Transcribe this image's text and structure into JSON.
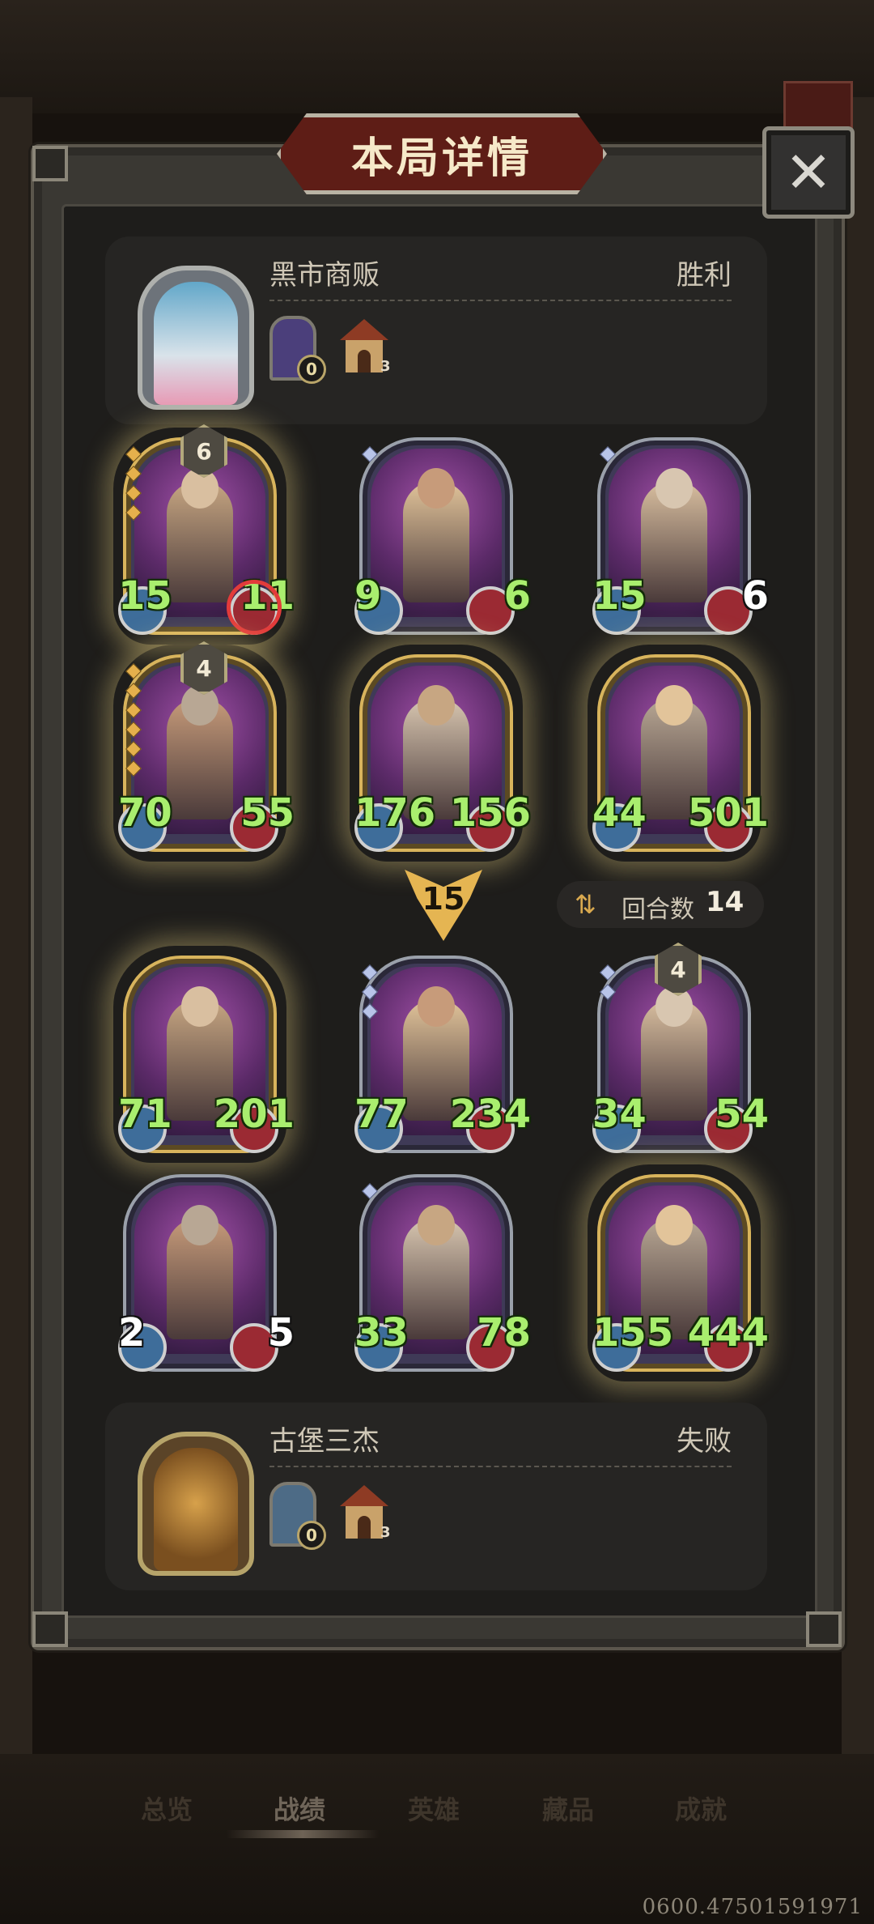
{
  "dialog": {
    "title": "本局详情",
    "close_icon": "close-icon"
  },
  "players": {
    "top": {
      "name": "黑市商贩",
      "result": "胜利",
      "items": [
        {
          "icon": "door-icon",
          "count": "0"
        },
        {
          "icon": "house-icon",
          "count": "3"
        }
      ]
    },
    "bottom": {
      "name": "古堡三杰",
      "result": "失败",
      "items": [
        {
          "icon": "door-icon",
          "count": "0"
        },
        {
          "icon": "house-icon",
          "count": "3"
        }
      ]
    }
  },
  "top_board": [
    {
      "name": "sword-knight",
      "attack": "15",
      "health": "11",
      "tier": "6",
      "frame": "gold",
      "pips": 4,
      "pip_color": "gold",
      "atk_color": "green",
      "hp_color": "green"
    },
    {
      "name": "pirate-captain",
      "attack": "9",
      "health": "6",
      "frame": "silver",
      "pips": 1,
      "pip_color": "silver",
      "atk_color": "green",
      "hp_color": "green"
    },
    {
      "name": "armored-paladin",
      "attack": "15",
      "health": "6",
      "frame": "silver",
      "pips": 1,
      "pip_color": "silver",
      "atk_color": "green",
      "hp_color": "white"
    },
    {
      "name": "pirate-bandana",
      "attack": "70",
      "health": "55",
      "tier": "4",
      "frame": "gold",
      "pips": 6,
      "pip_color": "gold",
      "atk_color": "green",
      "hp_color": "green"
    },
    {
      "name": "valkyrie",
      "attack": "176",
      "health": "156",
      "frame": "gold",
      "pips": 0,
      "pip_color": "gold",
      "atk_color": "green",
      "hp_color": "green"
    },
    {
      "name": "viking-warrior",
      "attack": "44",
      "health": "501",
      "frame": "gold",
      "pips": 0,
      "pip_color": "gold",
      "atk_color": "green",
      "hp_color": "green"
    }
  ],
  "round": {
    "turn_badge": "15",
    "label": "回合数",
    "value": "14",
    "icon": "swap-icon"
  },
  "bottom_board": [
    {
      "name": "archer",
      "attack": "71",
      "health": "201",
      "frame": "gold",
      "pips": 0,
      "pip_color": "gold",
      "atk_color": "green",
      "hp_color": "green"
    },
    {
      "name": "engineer-pair",
      "attack": "77",
      "health": "234",
      "frame": "silver",
      "pips": 3,
      "pip_color": "silver",
      "atk_color": "green",
      "hp_color": "green"
    },
    {
      "name": "shield-warrior",
      "attack": "34",
      "health": "54",
      "tier": "4",
      "frame": "silver",
      "pips": 2,
      "pip_color": "silver",
      "atk_color": "green",
      "hp_color": "green"
    },
    {
      "name": "purple-brawler",
      "attack": "2",
      "health": "5",
      "frame": "silver",
      "pips": 0,
      "pip_color": "silver",
      "atk_color": "white",
      "hp_color": "white"
    },
    {
      "name": "armored-paladin",
      "attack": "33",
      "health": "78",
      "frame": "silver",
      "pips": 1,
      "pip_color": "silver",
      "atk_color": "green",
      "hp_color": "green"
    },
    {
      "name": "blacksmith-girl",
      "attack": "155",
      "health": "444",
      "frame": "gold",
      "pips": 0,
      "pip_color": "gold",
      "atk_color": "green",
      "hp_color": "green"
    }
  ],
  "nav": {
    "tabs": [
      "总览",
      "战绩",
      "英雄",
      "藏品",
      "成就"
    ],
    "active": "战绩"
  },
  "version": "0600.47501591971",
  "colors": {
    "stat_green": "#a9ee6e",
    "gold_frame": "#d8b45c",
    "silver_frame": "#9aa0aa",
    "title_red": "#5e1d16"
  }
}
